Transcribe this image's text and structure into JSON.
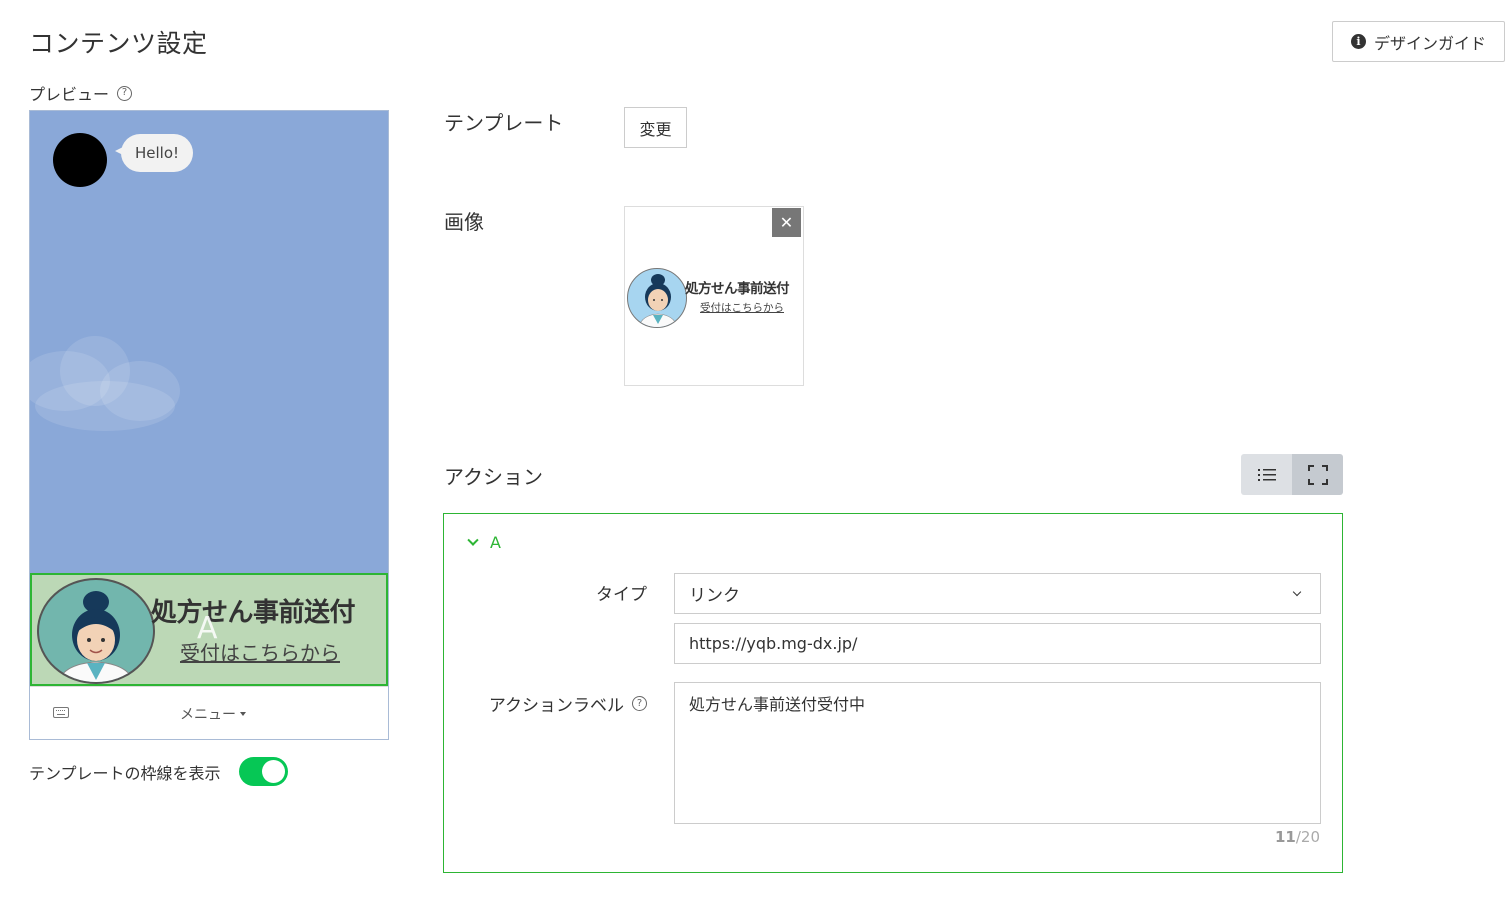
{
  "header": {
    "title": "コンテンツ設定",
    "design_guide_label": "デザインガイド"
  },
  "preview": {
    "label": "プレビュー",
    "chat_bubble": "Hello!",
    "rich_menu": {
      "title": "処方せん事前送付",
      "subtitle": "受付はこちらから",
      "area_label": "A"
    },
    "menu_bar_label": "メニュー"
  },
  "template_border_toggle": {
    "label": "テンプレートの枠線を表示",
    "on": true
  },
  "template": {
    "label": "テンプレート",
    "change_button": "変更"
  },
  "image": {
    "label": "画像",
    "thumbnail_title": "処方せん事前送付",
    "thumbnail_subtitle": "受付はこちらから"
  },
  "action": {
    "label": "アクション",
    "panel": {
      "name": "A",
      "type_label": "タイプ",
      "type_value": "リンク",
      "url_value": "https://yqb.mg-dx.jp/",
      "action_label_label": "アクションラベル",
      "action_label_value": "処方せん事前送付受付中",
      "char_count": "11",
      "char_max": "/20"
    }
  },
  "colors": {
    "accent_green": "#06c755",
    "border_green": "#2db534",
    "chat_background": "#8aa8d8",
    "rich_menu_background": "#bcd8b6"
  }
}
